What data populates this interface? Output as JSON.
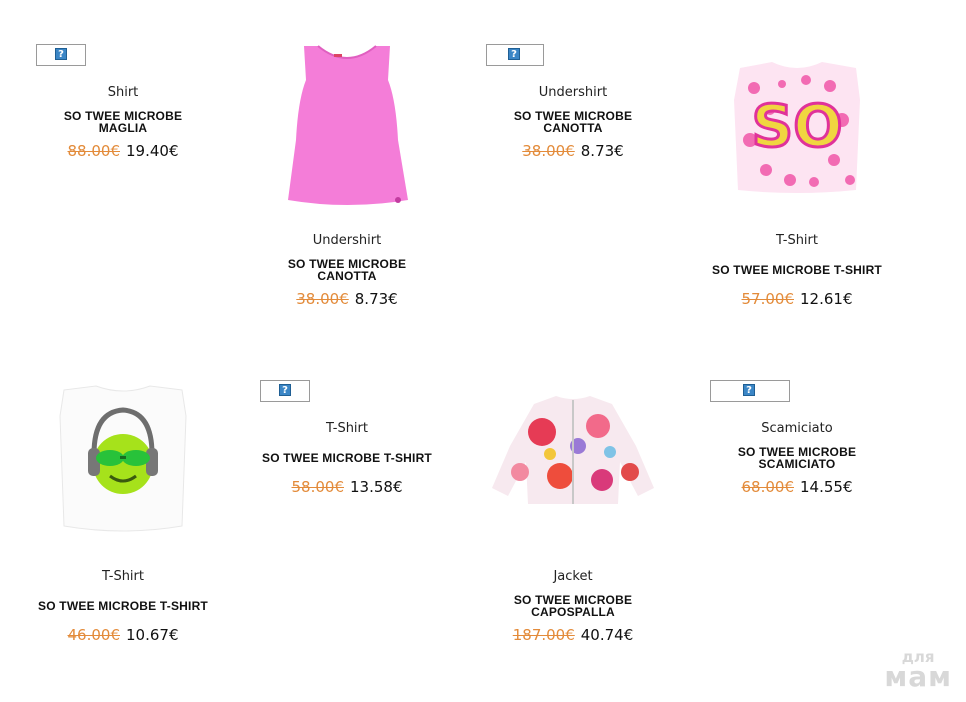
{
  "products": [
    {
      "category": "Shirt",
      "name_1": "SO TWEE MICROBE",
      "name_2": "MAGLIA",
      "old_price": "88.00€",
      "price": "19.40€",
      "image": "broken-image-icon"
    },
    {
      "category": "Undershirt",
      "name_1": "SO TWEE MICROBE",
      "name_2": "CANOTTA",
      "old_price": "38.00€",
      "price": "8.73€",
      "image": "pink-tank-dress"
    },
    {
      "category": "Undershirt",
      "name_1": "SO TWEE MICROBE",
      "name_2": "CANOTTA",
      "old_price": "38.00€",
      "price": "8.73€",
      "image": "broken-image-icon"
    },
    {
      "category": "T-Shirt",
      "name_1": "SO TWEE MICROBE T-SHIRT",
      "name_2": "",
      "old_price": "57.00€",
      "price": "12.61€",
      "image": "leopard-print-tshirt"
    },
    {
      "category": "T-Shirt",
      "name_1": "SO TWEE MICROBE T-SHIRT",
      "name_2": "",
      "old_price": "46.00€",
      "price": "10.67€",
      "image": "smiley-headphones-tshirt"
    },
    {
      "category": "T-Shirt",
      "name_1": "SO TWEE MICROBE T-SHIRT",
      "name_2": "",
      "old_price": "58.00€",
      "price": "13.58€",
      "image": "broken-image-icon"
    },
    {
      "category": "Jacket",
      "name_1": "SO TWEE MICROBE",
      "name_2": "CAPOSPALLA",
      "old_price": "187.00€",
      "price": "40.74€",
      "image": "floral-jacket"
    },
    {
      "category": "Scamiciato",
      "name_1": "SO TWEE MICROBE",
      "name_2": "SCAMICIATO",
      "old_price": "68.00€",
      "price": "14.55€",
      "image": "broken-image-icon"
    }
  ],
  "broken_image_glyph": "?",
  "watermark": {
    "line1": "для",
    "line2": "мам"
  },
  "colors": {
    "old_price": "#e38b3a",
    "price": "#111111"
  }
}
